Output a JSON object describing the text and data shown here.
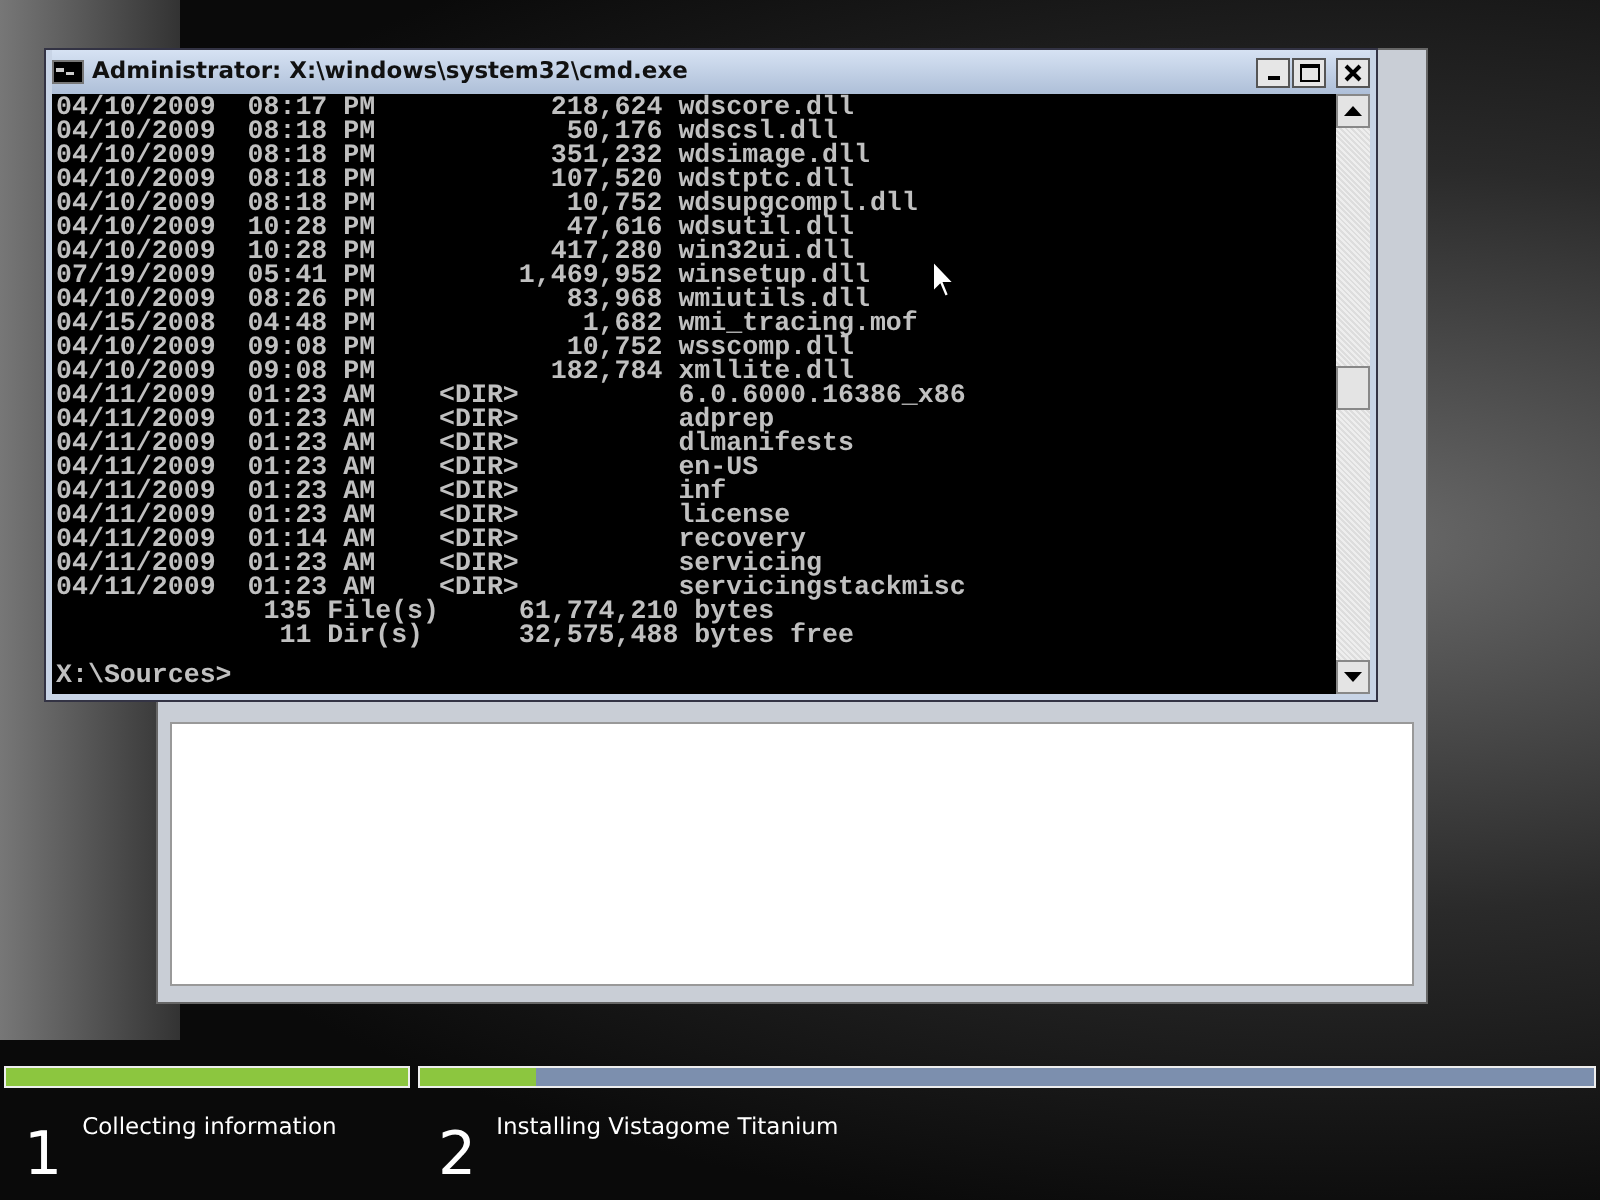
{
  "console_window": {
    "title": "Administrator: X:\\windows\\system32\\cmd.exe",
    "lines": [
      "04/10/2009  08:17 PM           218,624 wdscore.dll",
      "04/10/2009  08:18 PM            50,176 wdscsl.dll",
      "04/10/2009  08:18 PM           351,232 wdsimage.dll",
      "04/10/2009  08:18 PM           107,520 wdstptc.dll",
      "04/10/2009  08:18 PM            10,752 wdsupgcompl.dll",
      "04/10/2009  10:28 PM            47,616 wdsutil.dll",
      "04/10/2009  10:28 PM           417,280 win32ui.dll",
      "07/19/2009  05:41 PM         1,469,952 winsetup.dll",
      "04/10/2009  08:26 PM            83,968 wmiutils.dll",
      "04/15/2008  04:48 PM             1,682 wmi_tracing.mof",
      "04/10/2009  09:08 PM            10,752 wsscomp.dll",
      "04/10/2009  09:08 PM           182,784 xmllite.dll",
      "04/11/2009  01:23 AM    <DIR>          6.0.6000.16386_x86",
      "04/11/2009  01:23 AM    <DIR>          adprep",
      "04/11/2009  01:23 AM    <DIR>          dlmanifests",
      "04/11/2009  01:23 AM    <DIR>          en-US",
      "04/11/2009  01:23 AM    <DIR>          inf",
      "04/11/2009  01:23 AM    <DIR>          license",
      "04/11/2009  01:14 AM    <DIR>          recovery",
      "04/11/2009  01:23 AM    <DIR>          servicing",
      "04/11/2009  01:23 AM    <DIR>          servicingstackmisc",
      "             135 File(s)     61,774,210 bytes",
      "              11 Dir(s)      32,575,488 bytes free"
    ],
    "prompt": "X:\\Sources>"
  },
  "progress": [
    {
      "level": 1,
      "number": "1",
      "label": "Collecting information"
    },
    {
      "level": 0.1,
      "number": "2",
      "label": "Installing Vistagome Titanium"
    }
  ]
}
